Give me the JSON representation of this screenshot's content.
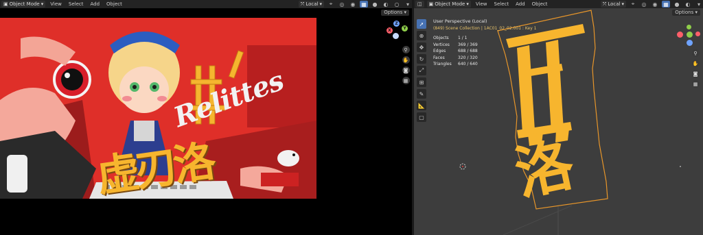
{
  "left": {
    "header": {
      "mode": "Object Mode",
      "menus": [
        "View",
        "Select",
        "Add",
        "Object"
      ],
      "transform": "Local",
      "options": "Options"
    },
    "artwork_text": {
      "script": "Relittes",
      "kanji": "虚刃洛"
    }
  },
  "right": {
    "header": {
      "mode": "Object Mode",
      "menus": [
        "View",
        "Select",
        "Add",
        "Object"
      ],
      "transform": "Local",
      "options": "Options"
    },
    "overlay": {
      "title": "User Perspective (Local)",
      "collection": "(849) Scene Collection | 1AC01_02_02.001 : Key 1",
      "stats": [
        {
          "label": "Objects",
          "value": "1 / 1"
        },
        {
          "label": "Vertices",
          "value": "369 / 369"
        },
        {
          "label": "Edges",
          "value": "688 / 688"
        },
        {
          "label": "Faces",
          "value": "320 / 320"
        },
        {
          "label": "Triangles",
          "value": "640 / 640"
        }
      ]
    },
    "kanji": "洛"
  },
  "gizmo": {
    "x": "X",
    "y": "Y",
    "z": "Z"
  },
  "colors": {
    "accent": "#4772b3",
    "mesh": "#f7b52e",
    "outline": "#e8962a",
    "poster_red": "#e0302b"
  }
}
